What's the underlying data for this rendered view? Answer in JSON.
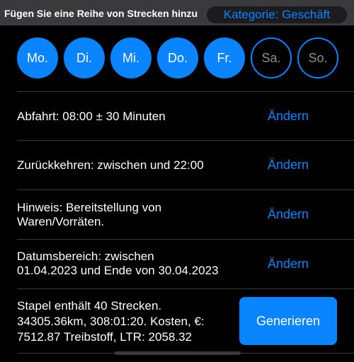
{
  "header": {
    "title": "Fügen Sie eine Reihe von Strecken hinzu",
    "category": "Kategorie: Geschäft"
  },
  "days": [
    {
      "label": "Mo.",
      "selected": true
    },
    {
      "label": "Di.",
      "selected": true
    },
    {
      "label": "Mi.",
      "selected": true
    },
    {
      "label": "Do.",
      "selected": true
    },
    {
      "label": "Fr.",
      "selected": true
    },
    {
      "label": "Sa.",
      "selected": false
    },
    {
      "label": "So.",
      "selected": false
    }
  ],
  "rows": {
    "departure": {
      "text": "Abfahrt: 08:00 ± 30 Minuten",
      "action": "Ändern"
    },
    "return": {
      "text": "Zurückkehren: zwischen und 22:00",
      "action": "Ändern"
    },
    "note": {
      "line1": "Hinweis: Bereitstellung von",
      "line2": "Waren/Vorräten.",
      "action": "Ändern"
    },
    "date_range": {
      "line1": "Datumsbereich:  zwischen",
      "line2": "01.04.2023 und Ende von 30.04.2023",
      "action": "Ändern"
    }
  },
  "summary": {
    "line1": "Stapel enthält 40 Strecken.",
    "line2": "34305.36km, 308:01:20. Kosten, €:",
    "line3": "7512.87 Treibstoff, LTR: 2058.32",
    "button": "Generieren"
  },
  "colors": {
    "accent": "#0a84ff",
    "header_bg": "#3a3a3c",
    "background": "#000000"
  }
}
